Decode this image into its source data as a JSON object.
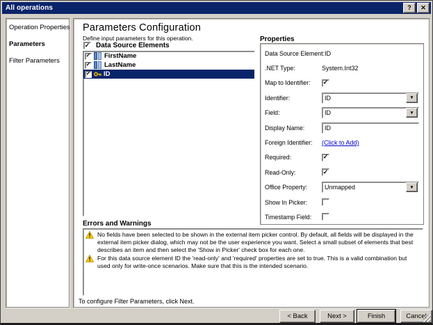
{
  "icons": {
    "help": "?",
    "close": "✕",
    "dropdown_arrow": "▼",
    "check": "✓",
    "warning": "!"
  },
  "window": {
    "title": "All operations"
  },
  "sidebar": {
    "items": [
      {
        "label": "Operation Properties",
        "active": false
      },
      {
        "label": "Parameters",
        "active": true
      },
      {
        "label": "Filter Parameters",
        "active": false
      }
    ]
  },
  "main": {
    "title": "Parameters Configuration",
    "subtitle": "Define input parameters for this operation.",
    "tree": {
      "header_label": "Data Source Elements",
      "header_checked": true,
      "items": [
        {
          "label": "FirstName",
          "icon": "column-icon",
          "checked": true,
          "selected": false
        },
        {
          "label": "LastName",
          "icon": "column-icon",
          "checked": true,
          "selected": false
        },
        {
          "label": "ID",
          "icon": "key-icon",
          "checked": true,
          "selected": true
        }
      ]
    },
    "properties": {
      "header": "Properties",
      "data_source_element_label": "Data Source Element:",
      "data_source_element_value": "ID",
      "net_type_label": ".NET Type:",
      "net_type_value": "System.Int32",
      "map_to_identifier_label": "Map to Identifier:",
      "map_to_identifier_checked": true,
      "identifier_label": "Identifier:",
      "identifier_value": "ID",
      "field_label": "Field:",
      "field_value": "ID",
      "display_name_label": "Display Name:",
      "display_name_value": "ID",
      "foreign_identifier_label": "Foreign Identifier:",
      "foreign_identifier_link": "(Click to Add)",
      "required_label": "Required:",
      "required_checked": true,
      "read_only_label": "Read-Only:",
      "read_only_checked": true,
      "office_property_label": "Office Property:",
      "office_property_value": "Unmapped",
      "show_in_picker_label": "Show In Picker:",
      "show_in_picker_checked": false,
      "timestamp_field_label": "Timestamp Field:",
      "timestamp_field_checked": false
    },
    "warnings": {
      "header": "Errors and Warnings",
      "items": [
        {
          "text": "No fields have been selected to be shown in the external item picker control. By default, all fields will be displayed in the external item picker dialog, which may not be the user experience you want. Select a small subset of elements that best describes an item and then select the 'Show in Picker' check box for each one."
        },
        {
          "text": "For this data source element ID the 'read-only' and 'required' properties are set to true. This is a valid combination but used only for write-once scenarios. Make sure that this is the intended scenario."
        }
      ]
    },
    "footer_hint": "To configure Filter Parameters, click Next."
  },
  "buttons": {
    "back": "< Back",
    "next": "Next >",
    "finish": "Finish",
    "cancel": "Cancel"
  },
  "colors": {
    "titlebar": "#0a246a",
    "selection": "#0a246a",
    "dialog": "#d4d0c8",
    "link": "#0000cc",
    "warning_yellow": "#ffcc00"
  }
}
